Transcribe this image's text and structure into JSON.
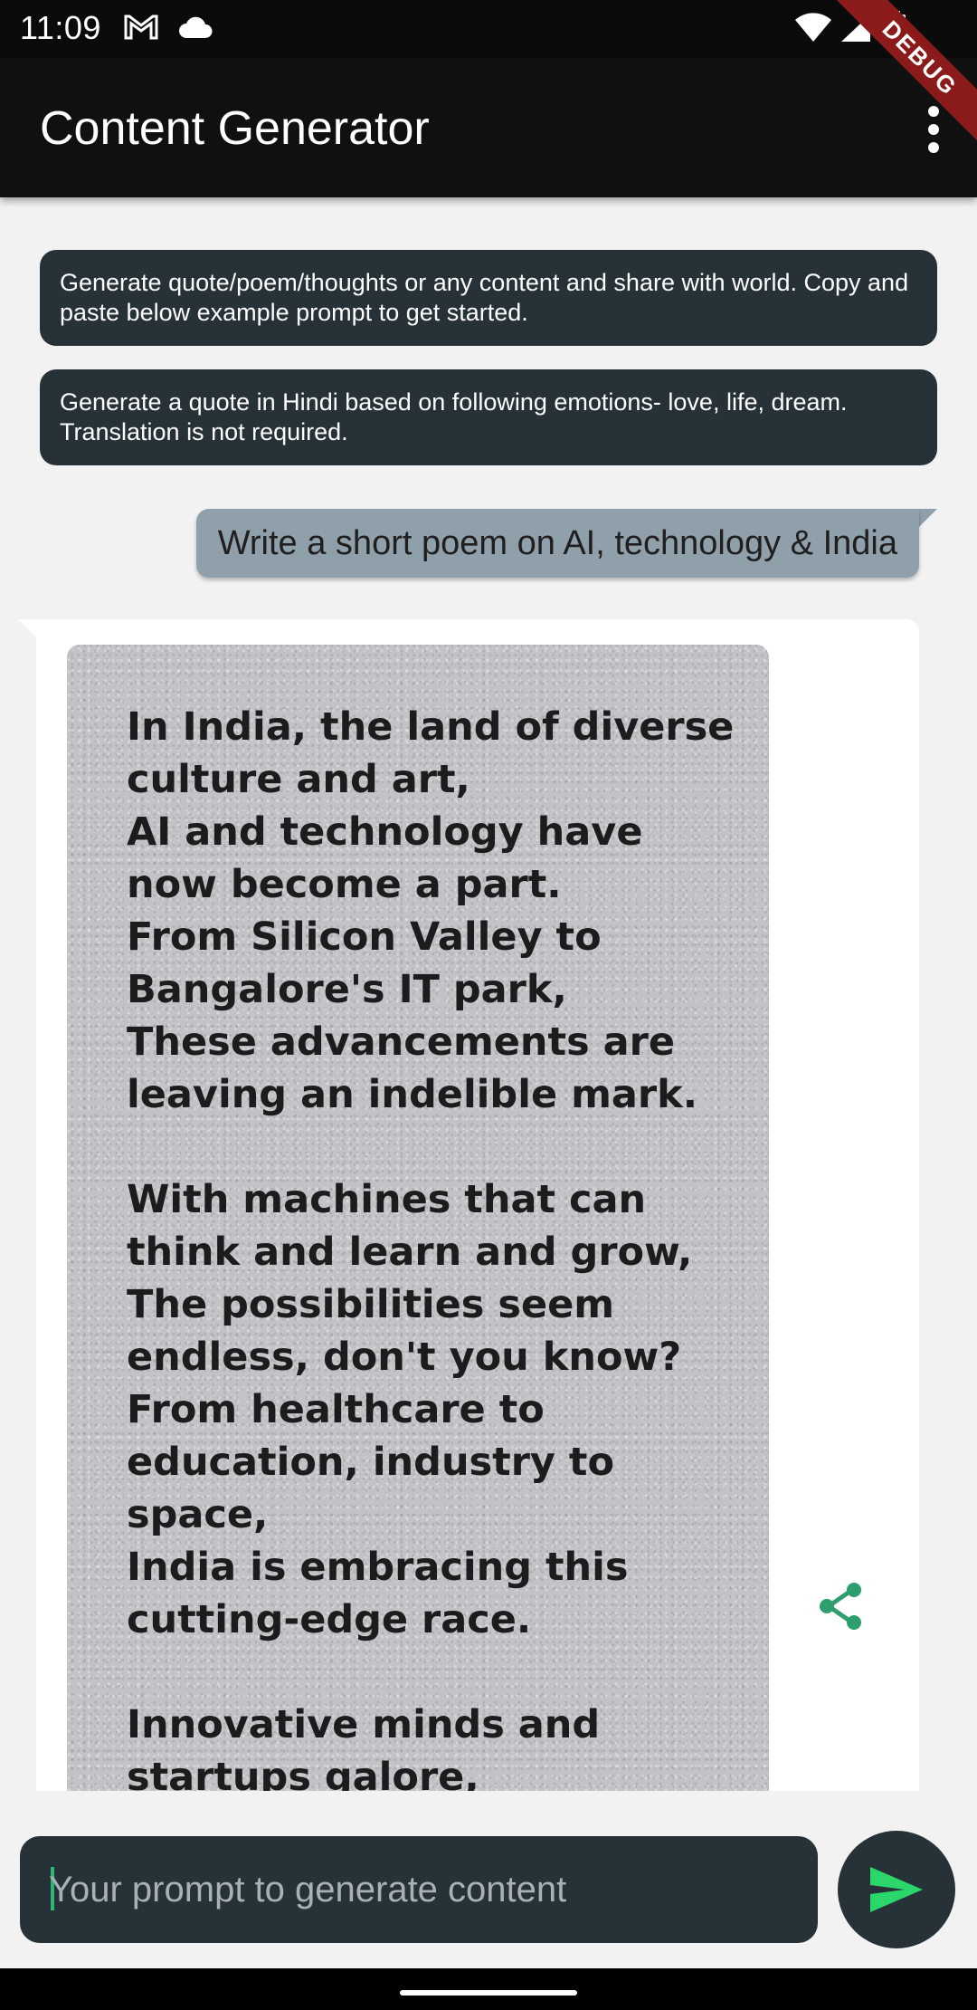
{
  "status_bar": {
    "time": "11:09",
    "icons": [
      "gmail-icon",
      "cloud-icon",
      "wifi-icon",
      "signal-icon",
      "battery-icon"
    ]
  },
  "app_bar": {
    "title": "Content Generator",
    "debug_banner": "DEBUG",
    "menu_icon": "more-vert-icon"
  },
  "info_cards": [
    "Generate quote/poem/thoughts or any content and share with world. Copy and paste below example prompt to get started.",
    "Generate a quote in Hindi based on following emotions- love, life, dream. Translation is not required."
  ],
  "user_message": "Write a short poem on AI, technology & India",
  "bot_message": {
    "poem": "In India, the land of diverse culture and art,\nAI and technology have now become a part.\nFrom Silicon Valley to Bangalore's IT park,\nThese advancements are leaving an indelible mark.\n\nWith machines that can think and learn and grow,\nThe possibilities seem endless, don't you know?\nFrom healthcare to education, industry to space,\nIndia is embracing this cutting-edge race.\n\nInnovative minds and startups galore,\nAI and technology are",
    "share_icon": "share-icon"
  },
  "input": {
    "placeholder": "Your prompt to generate content",
    "value": ""
  },
  "send_button_icon": "send-icon",
  "colors": {
    "app_bar": "#101010",
    "card_dark": "#263238",
    "user_bubble": "#8fa0aa",
    "accent_green": "#2bb673",
    "share_green": "#2e9e6e",
    "debug_red": "#8b1a1a"
  }
}
